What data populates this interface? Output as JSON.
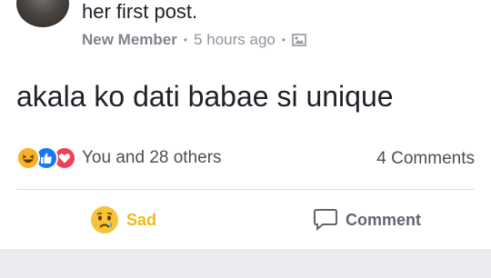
{
  "post": {
    "headline_fragment": "her first post.",
    "badge": "New Member",
    "time": "5 hours ago",
    "dot": "•",
    "privacy_icon": "photo-album-icon",
    "text": "akala ko dati babae si unique"
  },
  "reactions": {
    "icons": [
      "haha-icon",
      "like-icon",
      "love-icon"
    ],
    "summary": "You and 28 others",
    "comments": "4 Comments"
  },
  "actions": {
    "reaction_label": "Sad",
    "reaction_icon": "sad-face-icon",
    "comment_label": "Comment",
    "comment_icon": "comment-bubble-icon"
  },
  "colors": {
    "sad": "#f0ba15",
    "like": "#1877f2",
    "love": "#f33e58",
    "haha": "#f7b125"
  }
}
